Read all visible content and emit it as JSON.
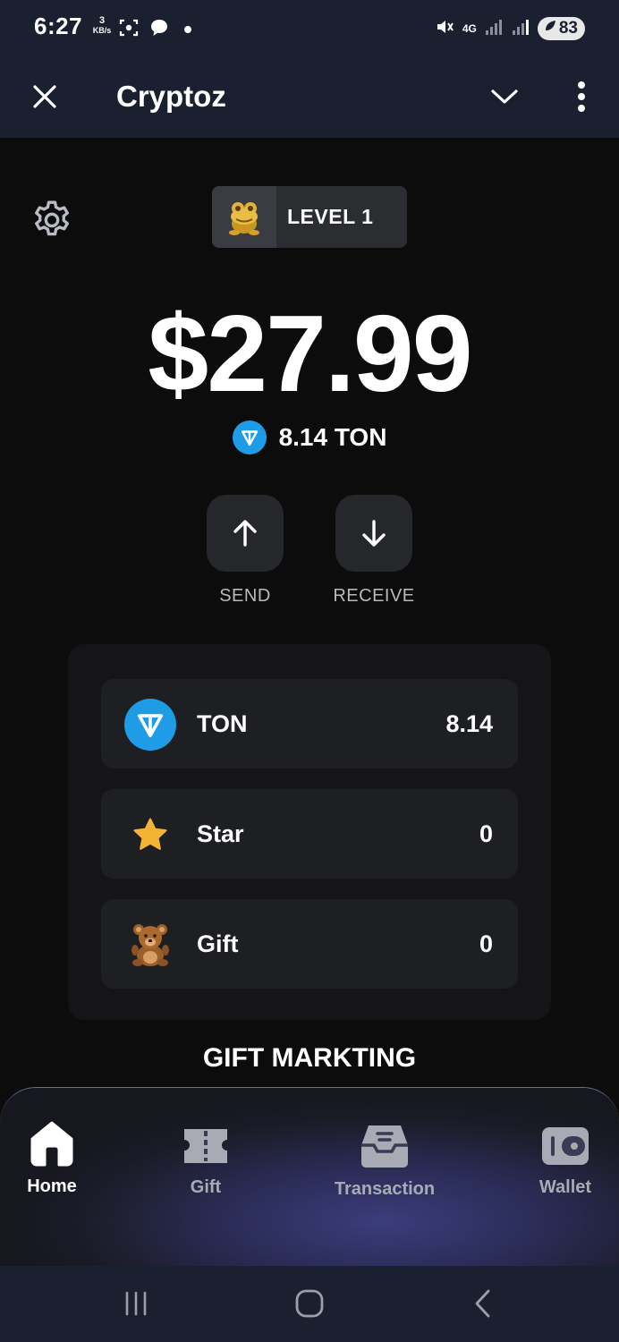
{
  "status_bar": {
    "time": "6:27",
    "speed_value": "3",
    "speed_unit": "KB/s",
    "network": "4G",
    "battery": "83"
  },
  "app_bar": {
    "title": "Cryptoz"
  },
  "level": {
    "label": "LEVEL 1"
  },
  "balance": {
    "usd": "$27.99",
    "ton": "8.14 TON"
  },
  "actions": [
    {
      "label": "SEND",
      "icon": "arrow-up-icon"
    },
    {
      "label": "RECEIVE",
      "icon": "arrow-down-icon"
    }
  ],
  "assets": [
    {
      "name": "TON",
      "value": "8.14",
      "icon": "ton-icon"
    },
    {
      "name": "Star",
      "value": "0",
      "icon": "star-icon"
    },
    {
      "name": "Gift",
      "value": "0",
      "icon": "teddy-bear-icon"
    }
  ],
  "section_heading": "GIFT MARKTING",
  "bottom_nav": [
    {
      "label": "Home",
      "icon": "home-icon",
      "active": true
    },
    {
      "label": "Gift",
      "icon": "ticket-icon",
      "active": false
    },
    {
      "label": "Transaction",
      "icon": "inbox-icon",
      "active": false
    },
    {
      "label": "Wallet",
      "icon": "wallet-icon",
      "active": false
    }
  ],
  "colors": {
    "background": "#0c0c0d",
    "header": "#1a2030",
    "ton_blue": "#1e9ce6",
    "star_gold": "#f5b335",
    "inactive_nav": "#a9abb4"
  }
}
